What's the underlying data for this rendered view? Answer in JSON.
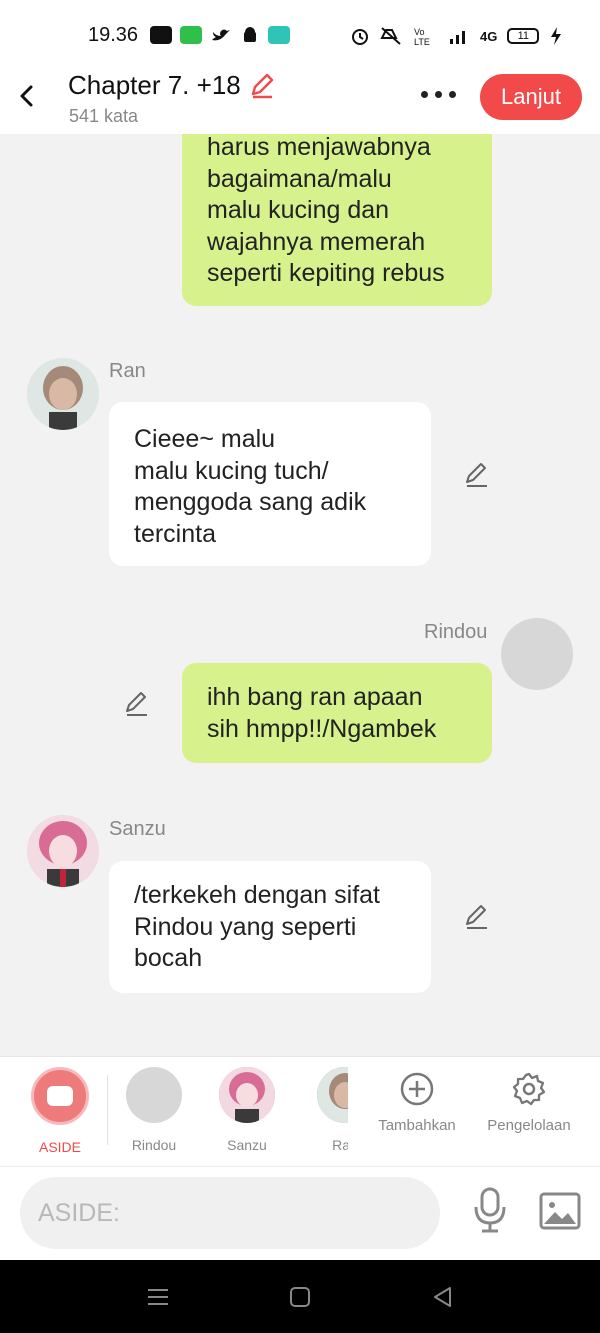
{
  "status_bar": {
    "time": "19.36",
    "network": "4G",
    "battery": "11"
  },
  "header": {
    "title": "Chapter 7. +18",
    "word_count": "541 kata",
    "next_label": "Lanjut"
  },
  "messages": [
    {
      "side": "right",
      "text": "harus menjawabnya\nbagaimana/malu\nmalu kucing dan\nwajahnya memerah\nseperti kepiting rebus"
    },
    {
      "side": "left",
      "sender": "Ran",
      "text": "Cieee~ malu\nmalu kucing tuch/\nmenggoda sang adik\ntercinta"
    },
    {
      "side": "right",
      "sender": "Rindou",
      "text": "ihh bang ran apaan\nsih hmpp!!/Ngambek"
    },
    {
      "side": "left",
      "sender": "Sanzu",
      "text": "/terkekeh dengan sifat\nRindou yang seperti\nbocah"
    }
  ],
  "character_bar": {
    "aside": "ASIDE",
    "rindou": "Rindou",
    "sanzu": "Sanzu",
    "ran": "Ran",
    "add": "Tambahkan",
    "manage": "Pengelolaan"
  },
  "composer": {
    "placeholder": "ASIDE:"
  },
  "colors": {
    "accent": "#f24a4a",
    "bubble_right": "#d7f28d",
    "bubble_left": "#ffffff",
    "background": "#f2f2f2"
  }
}
